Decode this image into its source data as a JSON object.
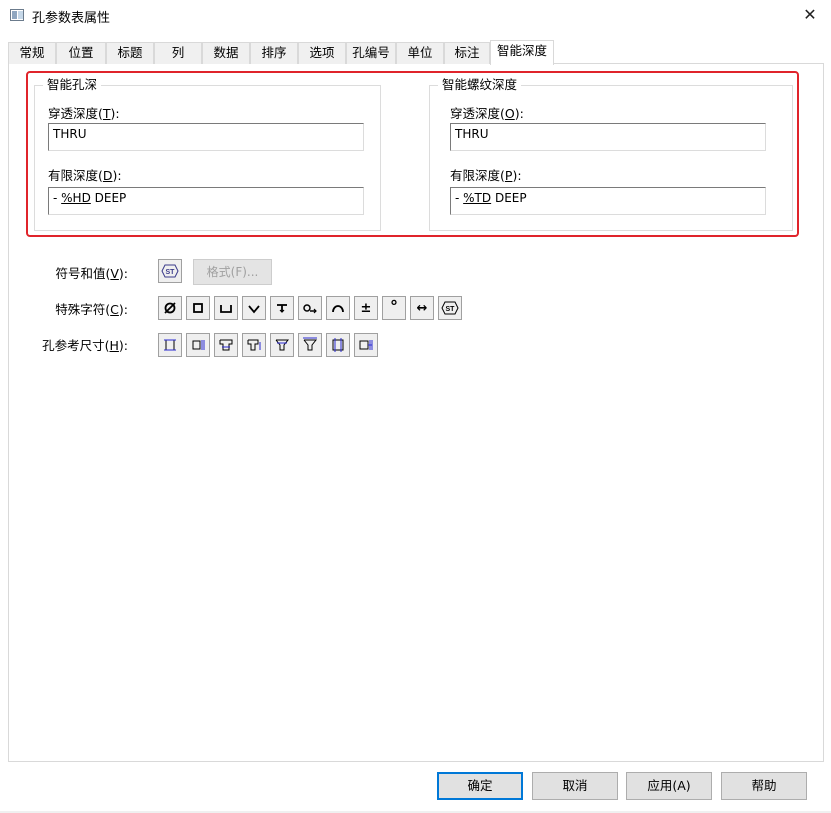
{
  "window": {
    "title": "孔参数表属性",
    "close_glyph": "✕"
  },
  "tabs": [
    {
      "label": "常规"
    },
    {
      "label": "位置"
    },
    {
      "label": "标题"
    },
    {
      "label": "列"
    },
    {
      "label": "数据"
    },
    {
      "label": "排序"
    },
    {
      "label": "选项"
    },
    {
      "label": "孔编号"
    },
    {
      "label": "单位"
    },
    {
      "label": "标注"
    },
    {
      "label": "智能深度",
      "active": true
    }
  ],
  "smart_hole_depth": {
    "group_title": "智能孔深",
    "through_label": {
      "text": "穿透深度(",
      "key": "T",
      "suffix": "):"
    },
    "through_value": "THRU",
    "limited_label": {
      "text": "有限深度(",
      "key": "D",
      "suffix": "):"
    },
    "limited_value": {
      "prefix": "- ",
      "var": "%HD",
      "suffix": " DEEP"
    }
  },
  "smart_thread_depth": {
    "group_title": "智能螺纹深度",
    "through_label": {
      "text": "穿透深度(",
      "key": "O",
      "suffix": "):"
    },
    "through_value": "THRU",
    "limited_label": {
      "text": "有限深度(",
      "key": "P",
      "suffix": "):"
    },
    "limited_value": {
      "prefix": "- ",
      "var": "%TD",
      "suffix": " DEEP"
    }
  },
  "symbols_row": {
    "label": {
      "text": "符号和值(",
      "key": "V",
      "suffix": "):"
    },
    "format_button": "格式(F)..."
  },
  "special_chars_row": {
    "label": {
      "text": "特殊字符(",
      "key": "C",
      "suffix": "):"
    },
    "buttons": [
      "diameter-icon",
      "square-icon",
      "counterbore-icon",
      "countersink-icon",
      "depth-icon",
      "thread-icon",
      "arc-icon",
      "plus-minus-icon",
      "degree-icon",
      "between-icon",
      "st-icon"
    ],
    "glyphs": {
      "plus_minus": "±",
      "degree": "°",
      "between": "↔"
    }
  },
  "hole_dims_row": {
    "label": {
      "text": "孔参考尺寸(",
      "key": "H",
      "suffix": "):"
    }
  },
  "footer": {
    "ok": "确定",
    "cancel": "取消",
    "apply": "应用(A)",
    "help": "帮助"
  },
  "colors": {
    "highlight": "#e0242b",
    "default_button_border": "#0078d7"
  }
}
